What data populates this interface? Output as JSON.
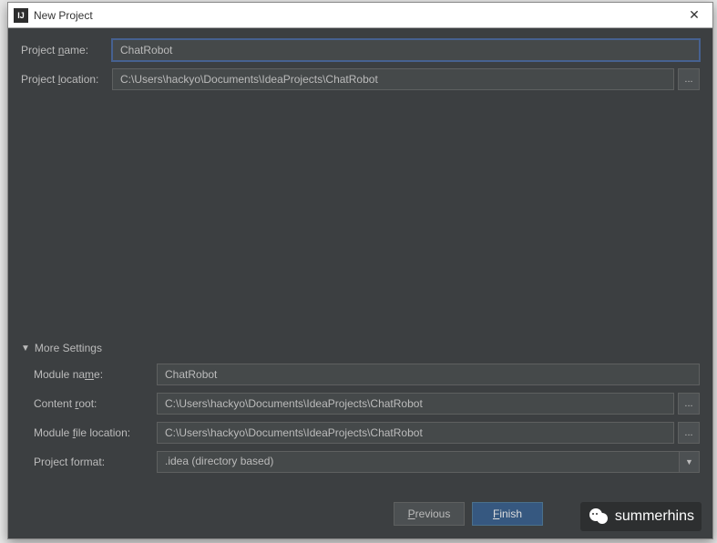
{
  "window": {
    "title": "New Project",
    "icon_label": "IJ"
  },
  "form": {
    "project_name_label": "Project name:",
    "project_name_value": "ChatRobot",
    "project_location_label": "Project location:",
    "project_location_value": "C:\\Users\\hackyo\\Documents\\IdeaProjects\\ChatRobot",
    "browse": "..."
  },
  "more_settings": {
    "header": "More Settings",
    "module_name_label": "Module name:",
    "module_name_value": "ChatRobot",
    "content_root_label": "Content root:",
    "content_root_value": "C:\\Users\\hackyo\\Documents\\IdeaProjects\\ChatRobot",
    "module_file_location_label": "Module file location:",
    "module_file_location_value": "C:\\Users\\hackyo\\Documents\\IdeaProjects\\ChatRobot",
    "project_format_label": "Project format:",
    "project_format_value": ".idea (directory based)"
  },
  "buttons": {
    "previous": "Previous",
    "finish": "Finish"
  },
  "watermark": {
    "text": "summerhins"
  }
}
